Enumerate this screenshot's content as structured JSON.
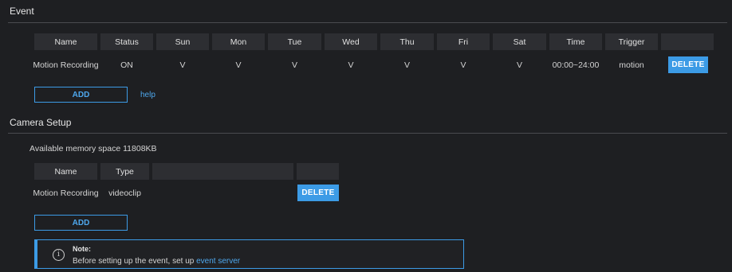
{
  "event": {
    "title": "Event",
    "columns": [
      "Name",
      "Status",
      "Sun",
      "Mon",
      "Tue",
      "Wed",
      "Thu",
      "Fri",
      "Sat",
      "Time",
      "Trigger",
      ""
    ],
    "rows": [
      {
        "name": "Motion Recording",
        "status": "ON",
        "sun": "V",
        "mon": "V",
        "tue": "V",
        "wed": "V",
        "thu": "V",
        "fri": "V",
        "sat": "V",
        "time": "00:00~24:00",
        "trigger": "motion",
        "delete_label": "DELETE"
      }
    ],
    "add_label": "ADD",
    "help_label": "help"
  },
  "camera_setup": {
    "title": "Camera Setup",
    "memory_label": "Available memory space",
    "memory_value": "11808KB",
    "columns": [
      "Name",
      "Type",
      "",
      ""
    ],
    "rows": [
      {
        "name": "Motion Recording",
        "type": "videoclip",
        "delete_label": "DELETE"
      }
    ],
    "add_label": "ADD"
  },
  "note": {
    "title": "Note:",
    "text": "Before setting up the event, set up",
    "link": "event server"
  },
  "colors": {
    "background": "#1e1f22",
    "header_bg": "#2d2e32",
    "accent": "#3c9be6"
  }
}
